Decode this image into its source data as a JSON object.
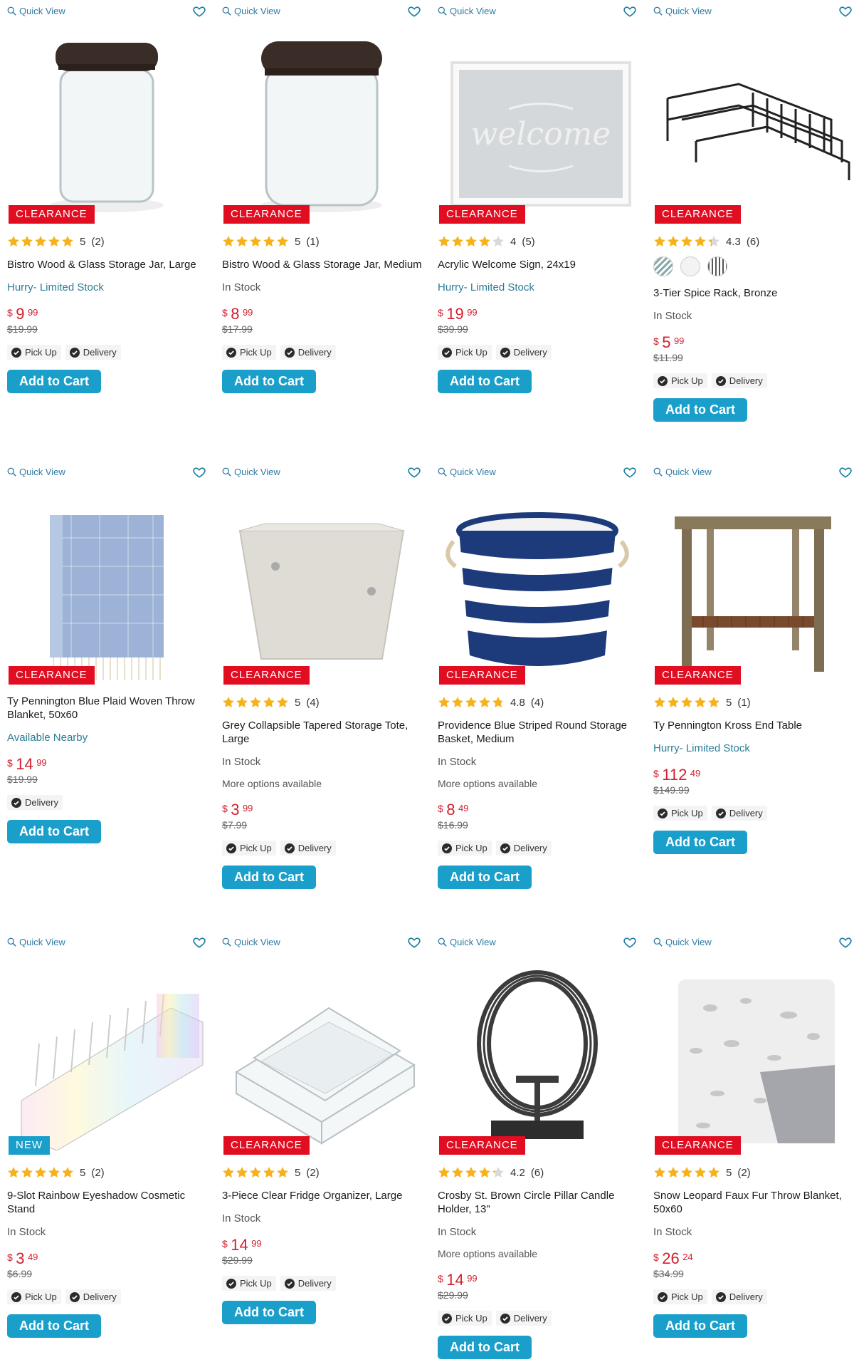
{
  "ui": {
    "quick_view": "Quick View",
    "add_to_cart": "Add to Cart",
    "pickup": "Pick Up",
    "delivery": "Delivery",
    "currency": "$"
  },
  "colors": {
    "accent": "#1a9fcb",
    "clearance": "#e10e22",
    "price": "#d21f2e",
    "star": "#f6b21b"
  },
  "products": [
    {
      "badge": "CLEARANCE",
      "rating": "5",
      "reviews": "(2)",
      "stars": 5,
      "title": "Bistro Wood & Glass Storage Jar, Large",
      "stock": "Hurry- Limited Stock",
      "price_dollars": "9",
      "price_cents": "99",
      "was": "$19.99",
      "fulfillment": [
        "Pick Up",
        "Delivery"
      ]
    },
    {
      "badge": "CLEARANCE",
      "rating": "5",
      "reviews": "(1)",
      "stars": 5,
      "title": "Bistro Wood & Glass Storage Jar, Medium",
      "stock": "In Stock",
      "price_dollars": "8",
      "price_cents": "99",
      "was": "$17.99",
      "fulfillment": [
        "Pick Up",
        "Delivery"
      ]
    },
    {
      "badge": "CLEARANCE",
      "rating": "4",
      "reviews": "(5)",
      "stars": 4,
      "title": "Acrylic Welcome Sign, 24x19",
      "stock": "Hurry- Limited Stock",
      "price_dollars": "19",
      "price_cents": "99",
      "was": "$39.99",
      "fulfillment": [
        "Pick Up",
        "Delivery"
      ]
    },
    {
      "badge": "CLEARANCE",
      "rating": "4.3",
      "reviews": "(6)",
      "stars": 4.3,
      "title": "3-Tier Spice Rack, Bronze",
      "stock": "In Stock",
      "price_dollars": "5",
      "price_cents": "99",
      "was": "$11.99",
      "fulfillment": [
        "Pick Up",
        "Delivery"
      ],
      "swatches": true
    },
    {
      "badge": "CLEARANCE",
      "title": "Ty Pennington Blue Plaid Woven Throw Blanket, 50x60",
      "stock": "Available Nearby",
      "price_dollars": "14",
      "price_cents": "99",
      "was": "$19.99",
      "fulfillment": [
        "Delivery"
      ]
    },
    {
      "badge": "CLEARANCE",
      "rating": "5",
      "reviews": "(4)",
      "stars": 5,
      "title": "Grey Collapsible Tapered Storage Tote, Large",
      "stock": "In Stock",
      "more": "More options available",
      "price_dollars": "3",
      "price_cents": "99",
      "was": "$7.99",
      "fulfillment": [
        "Pick Up",
        "Delivery"
      ]
    },
    {
      "badge": "CLEARANCE",
      "rating": "4.8",
      "reviews": "(4)",
      "stars": 4.8,
      "title": "Providence Blue Striped Round Storage Basket, Medium",
      "stock": "In Stock",
      "more": "More options available",
      "price_dollars": "8",
      "price_cents": "49",
      "was": "$16.99",
      "fulfillment": [
        "Pick Up",
        "Delivery"
      ]
    },
    {
      "badge": "CLEARANCE",
      "rating": "5",
      "reviews": "(1)",
      "stars": 5,
      "title": "Ty Pennington Kross End Table",
      "stock": "Hurry- Limited Stock",
      "price_dollars": "112",
      "price_cents": "49",
      "was": "$149.99",
      "fulfillment": [
        "Pick Up",
        "Delivery"
      ]
    },
    {
      "badge": "NEW",
      "rating": "5",
      "reviews": "(2)",
      "stars": 5,
      "title": "9-Slot Rainbow Eyeshadow Cosmetic Stand",
      "stock": "In Stock",
      "price_dollars": "3",
      "price_cents": "49",
      "was": "$6.99",
      "fulfillment": [
        "Pick Up",
        "Delivery"
      ]
    },
    {
      "badge": "CLEARANCE",
      "rating": "5",
      "reviews": "(2)",
      "stars": 5,
      "title": "3-Piece Clear Fridge Organizer, Large",
      "stock": "In Stock",
      "price_dollars": "14",
      "price_cents": "99",
      "was": "$29.99",
      "fulfillment": [
        "Pick Up",
        "Delivery"
      ]
    },
    {
      "badge": "CLEARANCE",
      "rating": "4.2",
      "reviews": "(6)",
      "stars": 4.2,
      "title": "Crosby St. Brown Circle Pillar Candle Holder, 13\"",
      "stock": "In Stock",
      "more": "More options available",
      "price_dollars": "14",
      "price_cents": "99",
      "was": "$29.99",
      "fulfillment": [
        "Pick Up",
        "Delivery"
      ]
    },
    {
      "badge": "CLEARANCE",
      "rating": "5",
      "reviews": "(2)",
      "stars": 5,
      "title": "Snow Leopard Faux Fur Throw Blanket, 50x60",
      "stock": "In Stock",
      "price_dollars": "26",
      "price_cents": "24",
      "was": "$34.99",
      "fulfillment": [
        "Pick Up",
        "Delivery"
      ]
    }
  ]
}
